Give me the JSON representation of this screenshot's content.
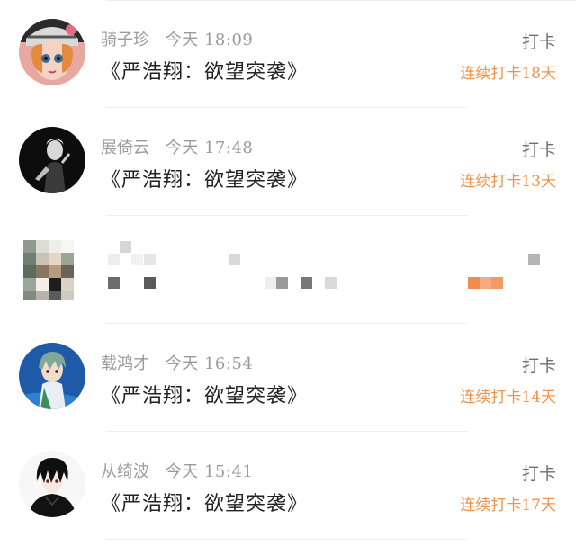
{
  "checkins": [
    {
      "avatar": "doll-girl-avatar",
      "name": "骑子珍",
      "day": "今天",
      "time": "18:09",
      "title": "《严浩翔：欲望突袭》",
      "action": "打卡",
      "streak": "连续打卡18天"
    },
    {
      "avatar": "dark-portrait-avatar",
      "name": "展倚云",
      "day": "今天",
      "time": "17:48",
      "title": "《严浩翔：欲望突袭》",
      "action": "打卡",
      "streak": "连续打卡13天"
    },
    {
      "pixelated": true
    },
    {
      "avatar": "anime-boy-blue-avatar",
      "name": "载鸿才",
      "day": "今天",
      "time": "16:54",
      "title": "《严浩翔：欲望突袭》",
      "action": "打卡",
      "streak": "连续打卡14天"
    },
    {
      "avatar": "anime-boy-black-hair-avatar",
      "name": "从绮波",
      "day": "今天",
      "time": "15:41",
      "title": "《严浩翔：欲望突袭》",
      "action": "打卡",
      "streak": "连续打卡17天"
    }
  ],
  "colors": {
    "streak": "#f0934a",
    "name": "#9b9b9b",
    "title": "#222222",
    "action": "#6f6f6f"
  }
}
